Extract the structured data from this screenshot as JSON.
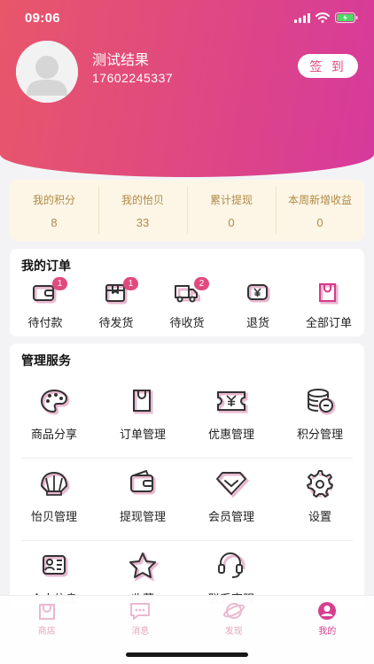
{
  "status": {
    "time": "09:06"
  },
  "profile": {
    "name": "测试结果",
    "phone": "17602245337",
    "signin_label": "签 到"
  },
  "stats": [
    {
      "label": "我的积分",
      "value": "8"
    },
    {
      "label": "我的怡贝",
      "value": "33"
    },
    {
      "label": "累计提现",
      "value": "0"
    },
    {
      "label": "本周新增收益",
      "value": "0"
    }
  ],
  "orders": {
    "title": "我的订单",
    "items": [
      {
        "label": "待付款",
        "icon": "wallet-icon",
        "badge": "1"
      },
      {
        "label": "待发货",
        "icon": "box-icon",
        "badge": "1"
      },
      {
        "label": "待收货",
        "icon": "truck-icon",
        "badge": "2"
      },
      {
        "label": "退货",
        "icon": "yen-return-icon",
        "badge": ""
      },
      {
        "label": "全部订单",
        "icon": "order-bag-icon",
        "badge": ""
      }
    ]
  },
  "services": {
    "title": "管理服务",
    "items": [
      {
        "label": "商品分享",
        "icon": "palette-icon"
      },
      {
        "label": "订单管理",
        "icon": "bag-icon"
      },
      {
        "label": "优惠管理",
        "icon": "coupon-icon"
      },
      {
        "label": "积分管理",
        "icon": "coins-icon"
      },
      {
        "label": "怡贝管理",
        "icon": "shell-icon"
      },
      {
        "label": "提现管理",
        "icon": "wallet-icon"
      },
      {
        "label": "会员管理",
        "icon": "diamond-icon"
      },
      {
        "label": "设置",
        "icon": "gear-icon"
      },
      {
        "label": "个人信息",
        "icon": "id-card-icon"
      },
      {
        "label": "收藏",
        "icon": "star-icon"
      },
      {
        "label": "联系客服",
        "icon": "headset-icon"
      }
    ]
  },
  "tabbar": [
    {
      "label": "商店",
      "icon": "shop-icon",
      "active": false
    },
    {
      "label": "消息",
      "icon": "message-icon",
      "active": false
    },
    {
      "label": "发现",
      "icon": "discover-icon",
      "active": false
    },
    {
      "label": "我的",
      "icon": "profile-icon",
      "active": true
    }
  ],
  "colors": {
    "accent": "#e04a7e",
    "gold": "#b08a45",
    "gold_bg": "#fdf6e7",
    "icon_stroke": "#333333",
    "icon_shadow": "#eab7d0"
  }
}
